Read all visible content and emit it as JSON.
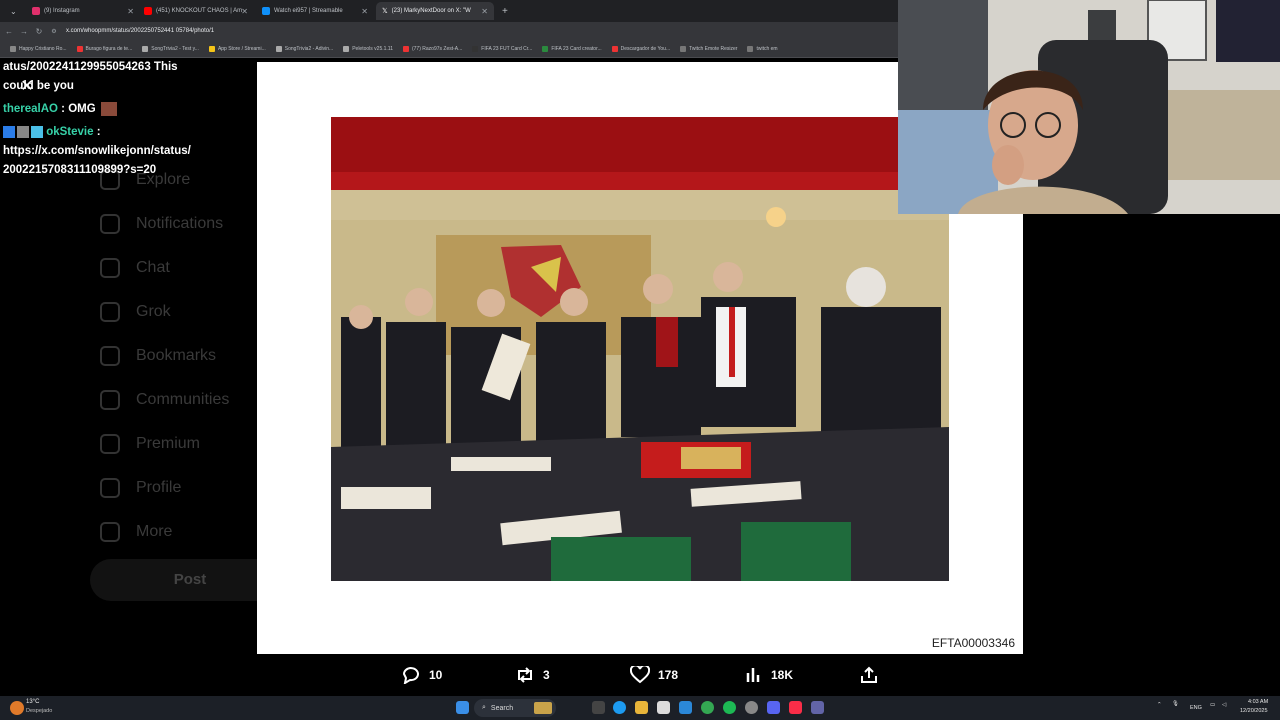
{
  "browser": {
    "tabs": [
      {
        "title": "(9) Instagram",
        "color": "#e1306c"
      },
      {
        "title": "(451) KNOCKOUT CHAOS | Am",
        "color": "#ff0000"
      },
      {
        "title": "Watch ei957 | Streamable",
        "color": "#0f90fa"
      },
      {
        "title": "(23) MarkyNextDoor on X: \"W",
        "color": "#111111"
      }
    ],
    "url": "x.com/whoopmm/status/2002250752441 05784/photo/1",
    "bookmarks": [
      "Happy Cristiano Ro...",
      "Burago figura de te...",
      "SongTrivia2 - Test y...",
      "App Store / Streami...",
      "SongTrivia2 - Adivin...",
      "Peletools v25.1.11",
      "(77) Razo97s Zest-A...",
      "FIFA 23 FUT Card Cr...",
      "FIFA 23 Card creator...",
      "Descargador de You...",
      "Twitch Emote Resizer",
      "twitch em"
    ]
  },
  "chat": {
    "lines": [
      {
        "user": "",
        "text": "atus/2002241129955054263 This"
      },
      {
        "user": "",
        "text": "could be you"
      },
      {
        "user": "therealAO",
        "text": ": OMG"
      },
      {
        "user": "okStevie",
        "text": ":"
      },
      {
        "user": "",
        "text": "https://x.com/snowlikejonn/status/"
      },
      {
        "user": "",
        "text": "2002215708311109899?s=20"
      }
    ]
  },
  "sidebar": {
    "items": [
      "Explore",
      "Notifications",
      "Chat",
      "Grok",
      "Bookmarks",
      "Communities",
      "Premium",
      "Profile",
      "More"
    ],
    "post": "Post"
  },
  "photo": {
    "id_label": "EFTA00003346"
  },
  "actions": {
    "replies": "10",
    "reposts": "3",
    "likes": "178",
    "views": "18K"
  },
  "taskbar": {
    "weather_temp": "13°C",
    "weather_desc": "Despejado",
    "search": "Search",
    "lang": "ENG",
    "time": "4:03 AM",
    "date": "12/20/2025"
  }
}
